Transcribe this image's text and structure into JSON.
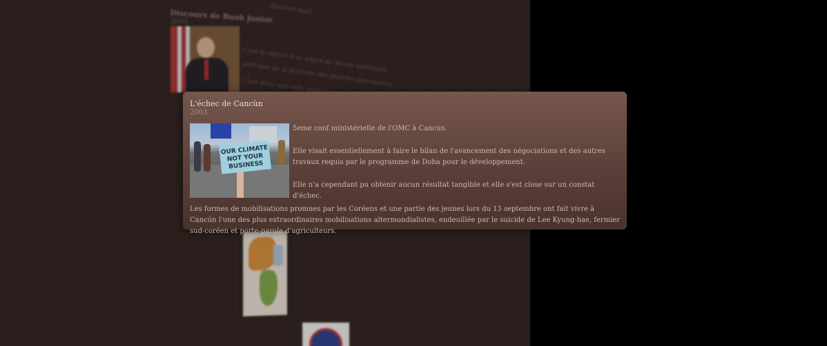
{
  "background": {
    "top_line": "... [blurred text]",
    "event_title": "Discours de Bush junior",
    "event_year": "2002",
    "lines": [
      "C'est le retour d'un esprit de devoir américain",
      "politique de la doctrine des guerres préventives",
      "C'est donc une telle politique ..."
    ]
  },
  "tooltip": {
    "title": "L'échec de Cancùn",
    "year": "2003",
    "sign_text": "OUR CLIMATE NOT YOUR BUSINESS",
    "paragraphs": [
      "5eme conf ministérielle de l'OMC à Cancun",
      "Elle visait essentiellement à faire le bilan de l'avancement des négociations et des autres travaux requis par le programme de Doha pour le développement.",
      "Elle n'a cependant pu obtenir aucun résultat tangible et elle s'est close sur un constat d'échec."
    ],
    "full_paragraph": "Les formes de mobilisations promues par les Coréens et une partie des jeunes lors du 13 septembre ont fait vivre à Cancún l'une des plus extraordinaires mobilisations altermondialistes, endeuillée par le suicide de Lee Kyung-hae, fermier sud-coréen et porte-parole d'agriculteurs."
  }
}
